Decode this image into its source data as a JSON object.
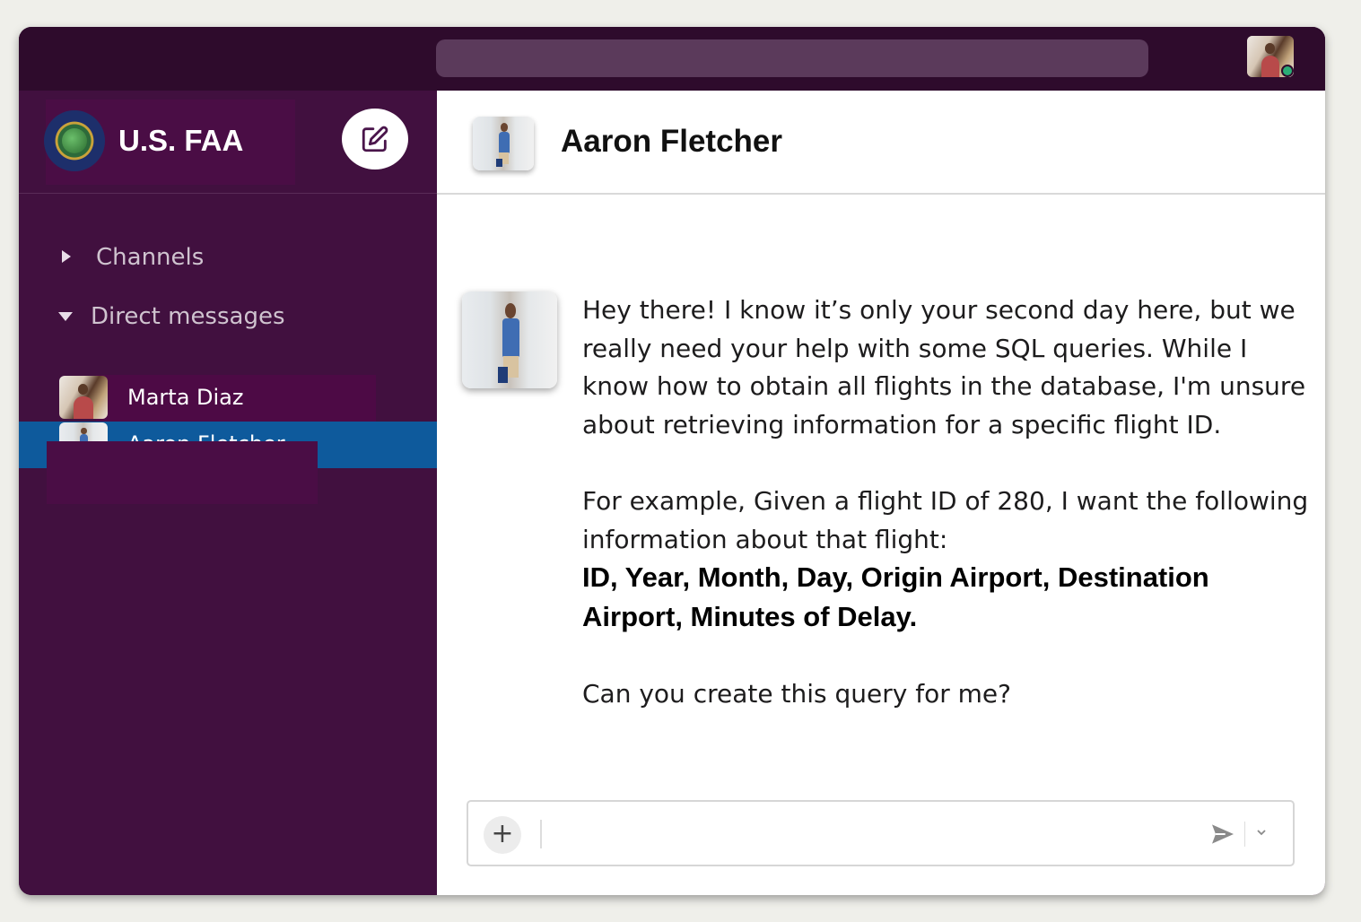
{
  "workspace": {
    "name": "U.S. FAA"
  },
  "sidebar": {
    "sections": {
      "channels": "Channels",
      "direct_messages": "Direct messages"
    },
    "dms": [
      {
        "name": "Marta Diaz",
        "active": false
      },
      {
        "name": "Aaron Fletcher",
        "active": true
      }
    ]
  },
  "chat": {
    "title": "Aaron Fletcher",
    "message": {
      "p1": "Hey there! I know it’s only your second day here, but we really need your help with some SQL queries. While I know how to obtain all flights in the database, I'm unsure about retrieving information for a specific flight ID.",
      "p2": "For example, Given a flight ID of 280, I want the following information about that flight:",
      "p2_bold": "ID, Year, Month, Day, Origin Airport, Destination Airport, Minutes of Delay.",
      "p3": "Can you create this query for me?"
    }
  },
  "composer": {
    "value": "",
    "plus_symbol": "+"
  },
  "colors": {
    "sidebar_bg": "#41103f",
    "topbar_bg": "#2e0b2c",
    "active_item": "#0e5a9c",
    "presence": "#2bac76"
  }
}
